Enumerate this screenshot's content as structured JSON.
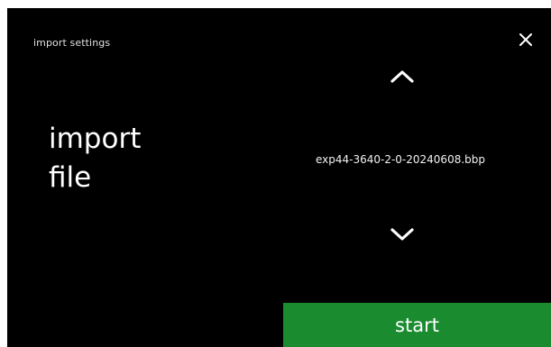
{
  "screen": {
    "title": "import settings",
    "heading_line1": "import",
    "heading_line2": "file",
    "selected_file": "exp44-3640-2-0-20240608.bbp",
    "start_label": "start",
    "icons": {
      "close": "close-icon",
      "up": "chevron-up-icon",
      "down": "chevron-down-icon"
    },
    "colors": {
      "background": "#000000",
      "text": "#ffffff",
      "start_button": "#1a8c2f"
    }
  }
}
